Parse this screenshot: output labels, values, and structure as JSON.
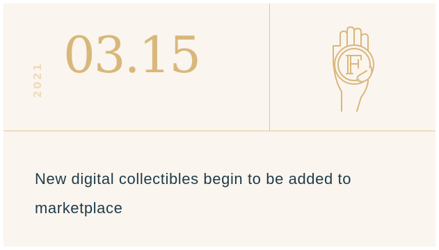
{
  "event": {
    "year": "2021",
    "date": "03.15",
    "description": "New digital collectibles begin to be added to marketplace",
    "icon": "hand-holding-coin-icon"
  },
  "colors": {
    "background": "#faf5ef",
    "accent_gold": "#d9b77a",
    "year_gold": "#ecdcb7",
    "divider": "#e3c995",
    "text": "#1f3b49"
  }
}
